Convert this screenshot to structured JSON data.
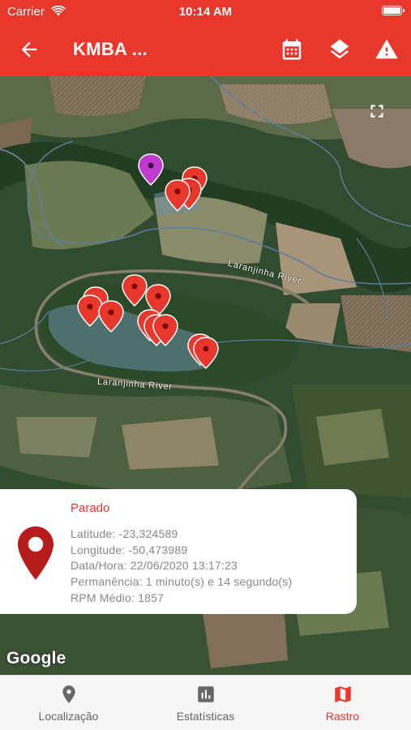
{
  "status_bar": {
    "carrier": "Carrier",
    "time": "10:14 AM"
  },
  "app_bar": {
    "title": "KMBA ...",
    "back_icon": "arrow-left-icon",
    "actions": [
      "calendar-icon",
      "layers-icon",
      "alert-icon"
    ],
    "color": "#e8382d"
  },
  "map": {
    "river_labels": [
      "Laranjinha River",
      "Laranjinha River"
    ],
    "attribution": "Google",
    "fullscreen_icon": "fullscreen-icon",
    "marker_colors": {
      "stop": "#e8382d",
      "current": "#c03ad0"
    }
  },
  "info_card": {
    "status": "Parado",
    "latitude": "Latitude: -23,324589",
    "longitude": "Longitude: -50,473989",
    "datetime": "Data/Hora: 22/06/2020 13:17:23",
    "permanence": "Permanência: 1 minuto(s) e 14 segundo(s)",
    "rpm": "RPM Médio: 1857",
    "pin_color": "#b71c1c"
  },
  "tabs": [
    {
      "label": "Localização",
      "icon": "location-pin-icon",
      "active": false
    },
    {
      "label": "Estatísticas",
      "icon": "bar-chart-icon",
      "active": false
    },
    {
      "label": "Rastro",
      "icon": "map-icon",
      "active": true
    }
  ]
}
